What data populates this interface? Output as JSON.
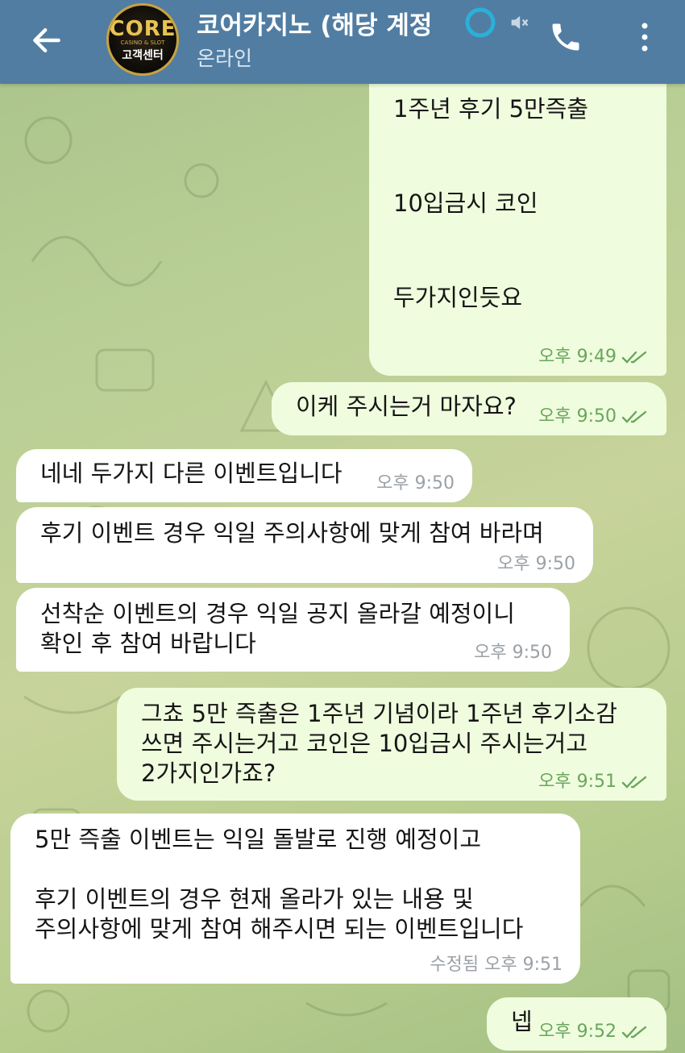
{
  "header": {
    "title": "코어카지노 (해당 계정",
    "status": "온라인",
    "avatar_logo": "CORE",
    "avatar_sub": "CASINO & SLOT",
    "avatar_center": "고객센터"
  },
  "messages": [
    {
      "dir": "out",
      "text": "1주년 후기 5만즉출\n\n\n10입금시 코인\n\n\n두가지인듯요",
      "time": "오후 9:49",
      "read": true
    },
    {
      "dir": "out",
      "text": "이케 주시는거 마자요?",
      "time": "오후 9:50",
      "read": true
    },
    {
      "dir": "in",
      "text": "네네 두가지 다른 이벤트입니다",
      "time": "오후 9:50"
    },
    {
      "dir": "in",
      "text": "후기 이벤트 경우 익일 주의사항에 맞게 참여 바라며",
      "time": "오후 9:50"
    },
    {
      "dir": "in",
      "text": "선착순 이벤트의 경우 익일 공지 올라갈 예정이니\n확인 후 참여 바랍니다",
      "time": "오후 9:50"
    },
    {
      "dir": "out",
      "text": "그쵸 5만 즉출은 1주년 기념이라 1주년 후기소감\n쓰면 주시는거고 코인은 10입금시 주시는거고\n2가지인가죠?",
      "time": "오후 9:51",
      "read": true
    },
    {
      "dir": "in",
      "text": "5만 즉출 이벤트는 익일 돌발로 진행 예정이고\n\n후기 이벤트의 경우 현재 올라가 있는 내용 및\n주의사항에 맞게 참여 해주시면 되는 이벤트입니다",
      "time": "수정됨 오후 9:51"
    },
    {
      "dir": "out",
      "text": "넵",
      "time": "오후 9:52",
      "read": true
    }
  ],
  "colors": {
    "header": "#517da2",
    "outgoing_bubble": "#effdde",
    "incoming_bubble": "#ffffff",
    "outgoing_meta": "#6aa55c",
    "incoming_meta": "#9aa1a7"
  },
  "icons": {
    "back": "arrow-left-icon",
    "phone": "phone-icon",
    "menu": "more-vertical-icon",
    "mute": "mute-icon",
    "read": "double-check-icon"
  }
}
